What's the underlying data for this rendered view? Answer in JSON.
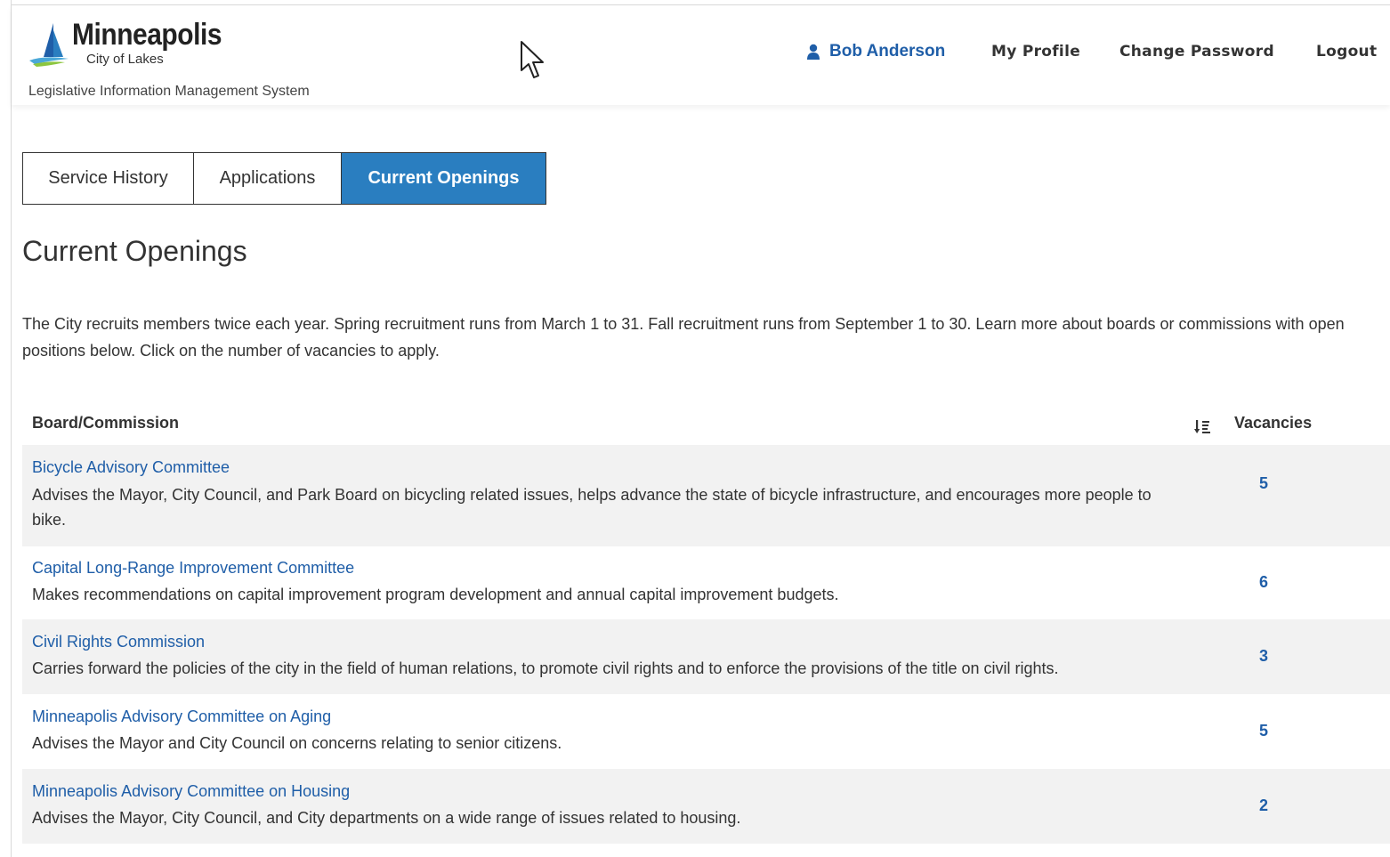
{
  "header": {
    "brand_title": "Minneapolis",
    "brand_subtitle": "City of Lakes",
    "system_name": "Legislative Information Management System",
    "user_name": "Bob Anderson",
    "nav": {
      "my_profile": "My Profile",
      "change_password": "Change Password",
      "logout": "Logout"
    }
  },
  "tabs": [
    {
      "label": "Service History",
      "active": false
    },
    {
      "label": "Applications",
      "active": false
    },
    {
      "label": "Current Openings",
      "active": true
    }
  ],
  "page_title": "Current Openings",
  "intro": "The City recruits members twice each year. Spring recruitment runs from March 1 to 31. Fall recruitment runs from September 1 to 30. Learn more about boards or commissions with open positions below. Click on the number of vacancies to apply.",
  "table": {
    "col_board": "Board/Commission",
    "col_vacancies": "Vacancies",
    "rows": [
      {
        "name": "Bicycle Advisory Committee",
        "desc": "Advises the Mayor, City Council, and Park Board on bicycling related issues, helps advance the state of bicycle infrastructure, and encourages more people to bike.",
        "vacancies": "5"
      },
      {
        "name": "Capital Long-Range Improvement Committee",
        "desc": "Makes recommendations on capital improvement program development and annual capital improvement budgets.",
        "vacancies": "6"
      },
      {
        "name": "Civil Rights Commission",
        "desc": "Carries forward the policies of the city in the field of human relations, to promote civil rights and to enforce the provisions of the title on civil rights.",
        "vacancies": "3"
      },
      {
        "name": "Minneapolis Advisory Committee on Aging",
        "desc": "Advises the Mayor and City Council on concerns relating to senior citizens.",
        "vacancies": "5"
      },
      {
        "name": "Minneapolis Advisory Committee on Housing",
        "desc": "Advises the Mayor, City Council, and City departments on a wide range of issues related to housing.",
        "vacancies": "2"
      }
    ]
  },
  "colors": {
    "link": "#1f5ea8",
    "active_tab": "#2a7ec0",
    "row_alt": "#f2f2f2"
  }
}
